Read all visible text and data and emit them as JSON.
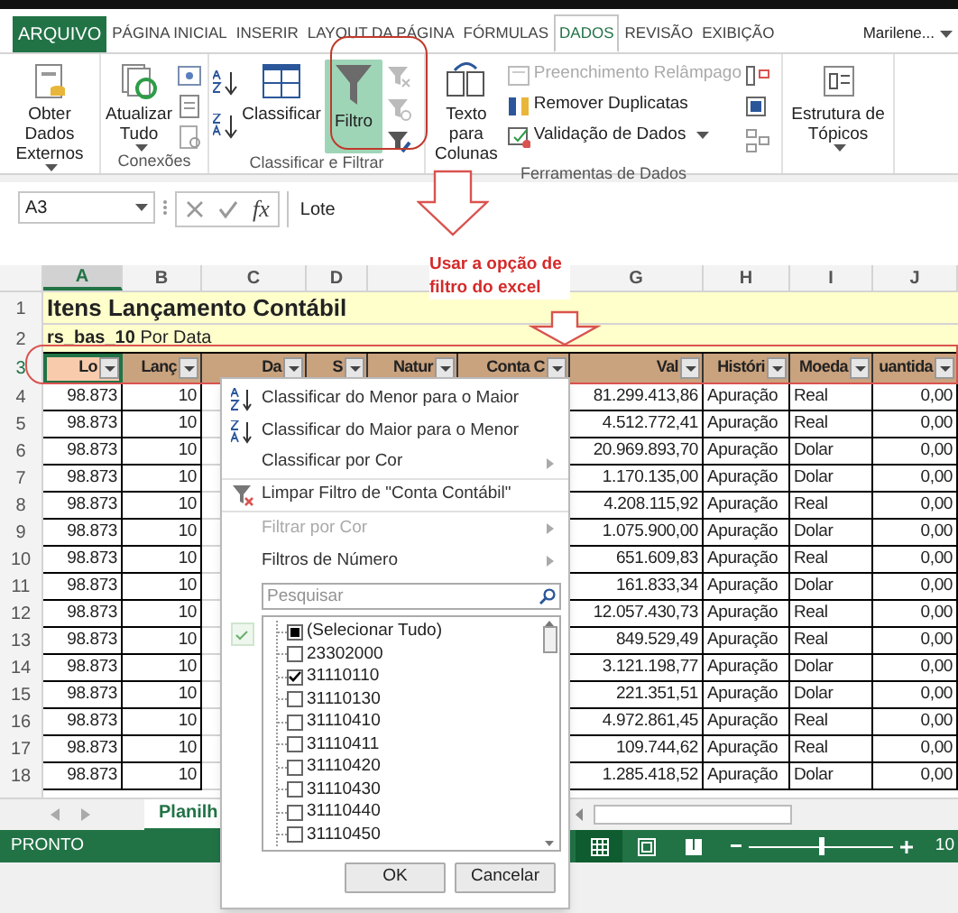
{
  "ribbon": {
    "tabs": [
      {
        "label": "ARQUIVO",
        "kind": "file",
        "selected": false
      },
      {
        "label": "PÁGINA INICIAL",
        "kind": "tab",
        "selected": false
      },
      {
        "label": "INSERIR",
        "kind": "tab",
        "selected": false
      },
      {
        "label": "LAYOUT DA PÁGINA",
        "kind": "tab",
        "selected": false
      },
      {
        "label": "FÓRMULAS",
        "kind": "tab",
        "selected": false
      },
      {
        "label": "DADOS",
        "kind": "tab",
        "selected": true
      },
      {
        "label": "REVISÃO",
        "kind": "tab",
        "selected": false
      },
      {
        "label": "EXIBIÇÃO",
        "kind": "tab",
        "selected": false
      }
    ],
    "account": "Marilene...",
    "get_data": {
      "label": "Obter Dados Externos",
      "dropdown": true
    },
    "connections": {
      "label": "Conexões",
      "refresh": {
        "label": "Atualizar Tudo",
        "dropdown": true
      }
    },
    "sort_filter": {
      "label": "Classificar e Filtrar",
      "sort": {
        "label": "Classificar"
      },
      "filter": {
        "label": "Filtro",
        "selected": true
      }
    },
    "data_tools": {
      "label": "Ferramentas de Dados",
      "text_to_columns": {
        "label": "Texto para Colunas"
      },
      "commands": [
        {
          "label": "Preenchimento Relâmpago",
          "disabled": true,
          "dropdown": false
        },
        {
          "label": "Remover Duplicatas",
          "disabled": false,
          "dropdown": false
        },
        {
          "label": "Validação de Dados",
          "disabled": false,
          "dropdown": true
        }
      ]
    },
    "outline": {
      "label": "Estrutura de Tópicos",
      "dropdown": true
    }
  },
  "formula_bar": {
    "name_box": "A3",
    "function_label": "fx",
    "value": "Lote"
  },
  "annotation": {
    "text": "Usar a opção de filtro do excel"
  },
  "sheet": {
    "columns": [
      {
        "label": "A"
      },
      {
        "label": "B"
      },
      {
        "label": "C"
      },
      {
        "label": "D"
      },
      {},
      {},
      {
        "label": "G"
      },
      {
        "label": "H"
      },
      {
        "label": "I"
      },
      {
        "label": "J"
      }
    ],
    "title_row": {
      "num": "1",
      "text": "Itens Lançamento Contábil"
    },
    "subtitle_row": {
      "num": "2",
      "text": "**rs_bas_10** Por Data"
    },
    "header_row": {
      "num": "3",
      "headers": [
        {
          "label": "Lo",
          "selected": true
        },
        {
          "label": "Lanç",
          "selected": false
        },
        {
          "label": "Da",
          "selected": false
        },
        {
          "label": "S",
          "selected": false
        },
        {
          "label": "Natur",
          "selected": false
        },
        {
          "label": "Conta C",
          "selected": false
        },
        {
          "label": "Val",
          "selected": false
        },
        {
          "label": "Históri",
          "selected": false
        },
        {
          "label": "Moeda",
          "selected": false
        },
        {
          "label": "uantida",
          "selected": false
        }
      ]
    },
    "rows": [
      {
        "num": "4",
        "cells": [
          "98.873",
          "10",
          "81.299.413,86",
          "Apuração",
          "Real",
          "0,00"
        ]
      },
      {
        "num": "5",
        "cells": [
          "98.873",
          "10",
          "4.512.772,41",
          "Apuração",
          "Real",
          "0,00"
        ]
      },
      {
        "num": "6",
        "cells": [
          "98.873",
          "10",
          "20.969.893,70",
          "Apuração",
          "Dolar",
          "0,00"
        ]
      },
      {
        "num": "7",
        "cells": [
          "98.873",
          "10",
          "1.170.135,00",
          "Apuração",
          "Dolar",
          "0,00"
        ]
      },
      {
        "num": "8",
        "cells": [
          "98.873",
          "10",
          "4.208.115,92",
          "Apuração",
          "Real",
          "0,00"
        ]
      },
      {
        "num": "9",
        "cells": [
          "98.873",
          "10",
          "1.075.900,00",
          "Apuração",
          "Dolar",
          "0,00"
        ]
      },
      {
        "num": "10",
        "cells": [
          "98.873",
          "10",
          "651.609,83",
          "Apuração",
          "Real",
          "0,00"
        ]
      },
      {
        "num": "11",
        "cells": [
          "98.873",
          "10",
          "161.833,34",
          "Apuração",
          "Dolar",
          "0,00"
        ]
      },
      {
        "num": "12",
        "cells": [
          "98.873",
          "10",
          "12.057.430,73",
          "Apuração",
          "Real",
          "0,00"
        ]
      },
      {
        "num": "13",
        "cells": [
          "98.873",
          "10",
          "849.529,49",
          "Apuração",
          "Real",
          "0,00"
        ]
      },
      {
        "num": "14",
        "cells": [
          "98.873",
          "10",
          "3.121.198,77",
          "Apuração",
          "Dolar",
          "0,00"
        ]
      },
      {
        "num": "15",
        "cells": [
          "98.873",
          "10",
          "221.351,51",
          "Apuração",
          "Dolar",
          "0,00"
        ]
      },
      {
        "num": "16",
        "cells": [
          "98.873",
          "10",
          "4.972.861,45",
          "Apuração",
          "Real",
          "0,00"
        ]
      },
      {
        "num": "17",
        "cells": [
          "98.873",
          "10",
          "109.744,62",
          "Apuração",
          "Real",
          "0,00"
        ]
      },
      {
        "num": "18",
        "cells": [
          "98.873",
          "10",
          "1.285.418,52",
          "Apuração",
          "Dolar",
          "0,00"
        ]
      }
    ]
  },
  "sheet_tabs": [
    {
      "label": "Planilh",
      "selected": true
    }
  ],
  "status_bar": {
    "text": "PRONTO",
    "views": [
      {
        "selected": true
      },
      {
        "selected": false
      },
      {
        "selected": false
      }
    ],
    "zoom_slider": {
      "level": 0.5
    },
    "zoom": "10"
  },
  "filter_menu": {
    "items": [
      {
        "kind": "sort_ascending",
        "label": "Classificar do Menor para o Maior",
        "disabled": false,
        "submenu": false
      },
      {
        "kind": "sort_descending",
        "label": "Classificar do Maior para o Menor",
        "disabled": false,
        "submenu": false
      },
      {
        "kind": "plain",
        "label": "Classificar por Cor",
        "disabled": false,
        "submenu": true
      },
      {
        "kind": "clear_filter",
        "label": "Limpar Filtro de \"Conta Contábil\"",
        "disabled": false,
        "submenu": false
      },
      {
        "kind": "plain",
        "label": "Filtrar por Cor",
        "disabled": true,
        "submenu": true
      },
      {
        "kind": "plain",
        "label": "Filtros de Número",
        "disabled": false,
        "submenu": true
      }
    ],
    "search": {
      "placeholder": "Pesquisar"
    },
    "values": [
      {
        "label": "(Selecionar Tudo)",
        "checked": false,
        "partial": true
      },
      {
        "label": "23302000",
        "checked": false,
        "partial": false
      },
      {
        "label": "31110110",
        "checked": true,
        "partial": false
      },
      {
        "label": "31110130",
        "checked": false,
        "partial": false
      },
      {
        "label": "31110410",
        "checked": false,
        "partial": false
      },
      {
        "label": "31110411",
        "checked": false,
        "partial": false
      },
      {
        "label": "31110420",
        "checked": false,
        "partial": false
      },
      {
        "label": "31110430",
        "checked": false,
        "partial": false
      },
      {
        "label": "31110440",
        "checked": false,
        "partial": false
      },
      {
        "label": "31110450",
        "checked": false,
        "partial": false
      }
    ],
    "buttons": [
      {
        "label": "OK"
      },
      {
        "label": "Cancelar"
      }
    ]
  }
}
